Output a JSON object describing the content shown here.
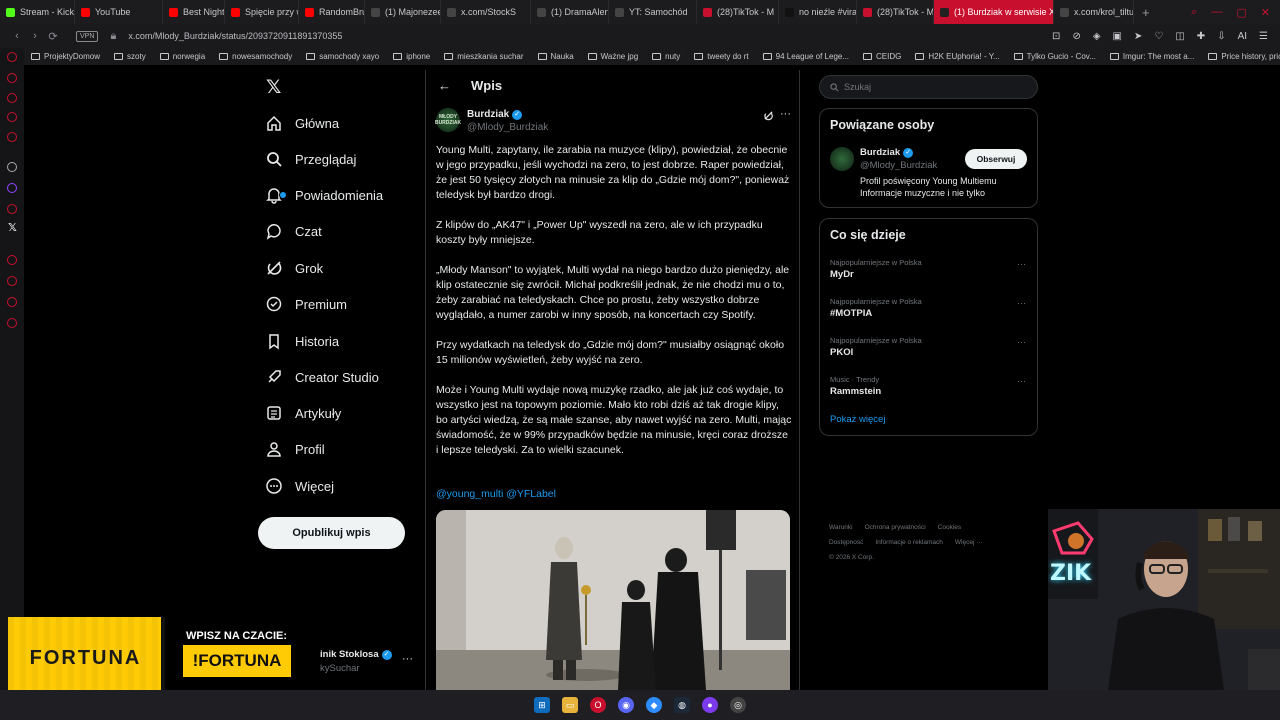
{
  "browser": {
    "tabs": [
      {
        "label": "Stream - Kick D",
        "color": "#53fc18",
        "active": false
      },
      {
        "label": "YouTube",
        "color": "#ff0000",
        "active": false
      },
      {
        "label": "Best Nightcore",
        "color": "#ff0000",
        "active": false
      },
      {
        "label": "Spięcie przy w",
        "color": "#ff0000",
        "active": false
      },
      {
        "label": "RandomBruce",
        "color": "#ff0000",
        "active": false
      },
      {
        "label": "(1) Majonezee",
        "color": "#444444",
        "active": false
      },
      {
        "label": "x.com/StockS",
        "color": "#444444",
        "active": false
      },
      {
        "label": "(1) DramaAlert",
        "color": "#444444",
        "active": false
      },
      {
        "label": "YT: Samochód",
        "color": "#444444",
        "active": false
      },
      {
        "label": "(28)TikTok - M",
        "color": "#c8102e",
        "active": false
      },
      {
        "label": "no nieźle #viral",
        "color": "#111111",
        "active": false
      },
      {
        "label": "(28)TikTok - M",
        "color": "#c8102e",
        "active": false
      },
      {
        "label": "(1) Burdziak w serwisie X",
        "color": "#222222",
        "active": true
      },
      {
        "label": "x.com/krol_tiltu",
        "color": "#444444",
        "active": false
      }
    ],
    "new_tab": "+",
    "vpn": "VPN",
    "url": "x.com/Mlody_Burdziak/status/2093720911891370355",
    "ai_label": "AI",
    "bookmarks": [
      "ProjektyDomow",
      "szoty",
      "norwegia",
      "nowesamochody",
      "samochody xayo",
      "iphone",
      "mieszkania suchar",
      "Nauka",
      "Ważne jpg",
      "nuty",
      "tweety do rt",
      "94 League of Lege...",
      "CEIDG",
      "H2K EUphoria! - Y...",
      "Tylko Gucio - Cov...",
      "Imgur: The most a...",
      "Price history, price..."
    ]
  },
  "nav": {
    "items": [
      {
        "label": "Główna",
        "icon": "home-icon"
      },
      {
        "label": "Przeglądaj",
        "icon": "search-icon"
      },
      {
        "label": "Powiadomienia",
        "icon": "bell-icon"
      },
      {
        "label": "Czat",
        "icon": "chat-icon"
      },
      {
        "label": "Grok",
        "icon": "grok-icon"
      },
      {
        "label": "Premium",
        "icon": "premium-icon"
      },
      {
        "label": "Historia",
        "icon": "bookmark-icon"
      },
      {
        "label": "Creator Studio",
        "icon": "rocket-icon"
      },
      {
        "label": "Artykuły",
        "icon": "article-icon"
      },
      {
        "label": "Profil",
        "icon": "profile-icon"
      },
      {
        "label": "Więcej",
        "icon": "more-circle-icon"
      }
    ],
    "post_button": "Opublikuj wpis"
  },
  "main": {
    "title": "Wpis",
    "post": {
      "name": "Burdziak",
      "handle": "@Mlody_Burdziak",
      "avatar_text": "MŁODY BURDZIAK",
      "paragraphs": [
        "Young Multi, zapytany, ile zarabia na muzyce (klipy), powiedział, że obecnie w jego przypadku, jeśli wychodzi na zero, to jest dobrze. Raper powiedział, że jest 50 tysięcy złotych na minusie za klip do „Gdzie mój dom?\", ponieważ teledysk był bardzo drogi.",
        "Z klipów do „AK47\" i „Power Up\" wyszedł na zero, ale w ich przypadku koszty były mniejsze.",
        "„Młody Manson\" to wyjątek, Multi wydał na niego bardzo dużo pieniędzy, ale klip ostatecznie się zwrócił. Michał podkreślił jednak, że nie chodzi mu o to, żeby zarabiać na teledyskach. Chce po prostu, żeby wszystko dobrze wyglądało, a numer zarobi w inny sposób, na koncertach czy Spotify.",
        "Przy wydatkach na teledysk do „Gdzie mój dom?\" musiałby osiągnąć około 15 milionów wyświetleń, żeby wyjść na zero.",
        "Może i Young Multi wydaje nową muzykę rzadko, ale jak już coś wydaje, to wszystko jest na topowym poziomie. Mało kto robi dziś aż tak drogie klipy, bo artyści wiedzą, że są małe szanse, aby nawet wyjść na zero. Multi, mając świadomość, że w 99% przypadków będzie na minusie, kręci coraz droższe i lepsze teledyski. Za to wielki szacunek."
      ],
      "tags": "@young_multi @YFLabel"
    }
  },
  "right": {
    "search_placeholder": "Szukaj",
    "related": {
      "title": "Powiązane osoby",
      "name": "Burdziak",
      "handle": "@Mlody_Burdziak",
      "follow": "Obserwuj",
      "bio_line1": "Profil poświęcony Young Multiemu",
      "bio_line2": "Informacje muzyczne i nie tylko"
    },
    "trends": {
      "title": "Co się dzieje",
      "items": [
        {
          "category": "Najpopularniejsze w Polska",
          "name": "MyDr"
        },
        {
          "category": "Najpopularniejsze w Polska",
          "name": "#MOTPIA"
        },
        {
          "category": "Najpopularniejsze w Polska",
          "name": "PKOl"
        },
        {
          "category": "Music · Trendy",
          "name": "Rammstein"
        }
      ],
      "show_more": "Pokaż więcej"
    },
    "footer": {
      "links_row1": [
        "Warunki",
        "Ochrona prywatności",
        "Cookies"
      ],
      "links_row2": [
        "Dostępność",
        "Informacje o reklamach",
        "Więcej ···"
      ],
      "copyright": "© 2026 X Corp."
    }
  },
  "overlay": {
    "fortuna_logo": "FORTUNA",
    "chat_label": "WPISZ NA CZACIE:",
    "chat_command": "!FORTUNA",
    "account_name": "inik Stoklosa",
    "account_handle": "kySuchar"
  },
  "webcam": {
    "neon_text": "ZIK"
  }
}
